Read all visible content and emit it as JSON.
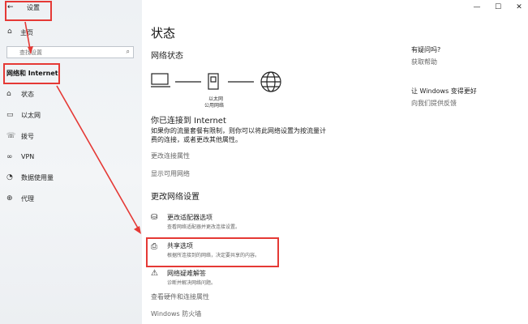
{
  "window": {
    "title": "设置",
    "back_glyph": "←",
    "minimize_glyph": "—",
    "maximize_glyph": "☐",
    "close_glyph": "✕"
  },
  "sidebar": {
    "home_label": "主页",
    "search_placeholder": "查找设置",
    "category_label": "网络和 Internet",
    "items": [
      {
        "label": "状态",
        "icon": "home-globe-icon"
      },
      {
        "label": "以太网",
        "icon": "ethernet-icon"
      },
      {
        "label": "拨号",
        "icon": "dial-up-icon"
      },
      {
        "label": "VPN",
        "icon": "vpn-icon"
      },
      {
        "label": "数据使用量",
        "icon": "data-usage-icon"
      },
      {
        "label": "代理",
        "icon": "proxy-globe-icon"
      }
    ]
  },
  "main": {
    "page_title": "状态",
    "network_status_heading": "网络状态",
    "ethernet_label": "以太网",
    "network_type_label": "公用网络",
    "connected_title": "你已连接到 Internet",
    "connected_desc_line1": "如果你的流量套餐有限制，则你可以将此网络设置为按流量计",
    "connected_desc_line2": "费的连接，或者更改其他属性。",
    "change_properties_link": "更改连接属性",
    "show_networks_link": "显示可用网络",
    "change_settings_heading": "更改网络设置",
    "options": [
      {
        "title": "更改适配器选项",
        "desc": "查看网络适配器并更改连接设置。",
        "icon": "adapter-icon"
      },
      {
        "title": "共享选项",
        "desc": "根据所连接到的网络，决定要共享的内容。",
        "icon": "sharing-icon"
      },
      {
        "title": "网络疑难解答",
        "desc": "诊断并解决网络问题。",
        "icon": "troubleshoot-icon"
      }
    ],
    "view_hardware_link": "查看硬件和连接属性",
    "firewall_link": "Windows 防火墙"
  },
  "help": {
    "question": "有疑问吗?",
    "get_help_link": "获取帮助",
    "improve_title": "让 Windows 变得更好",
    "feedback_link": "向我们提供反馈"
  },
  "colors": {
    "annotation_red": "#e53935",
    "sidebar_bg": "#eef1f4"
  }
}
